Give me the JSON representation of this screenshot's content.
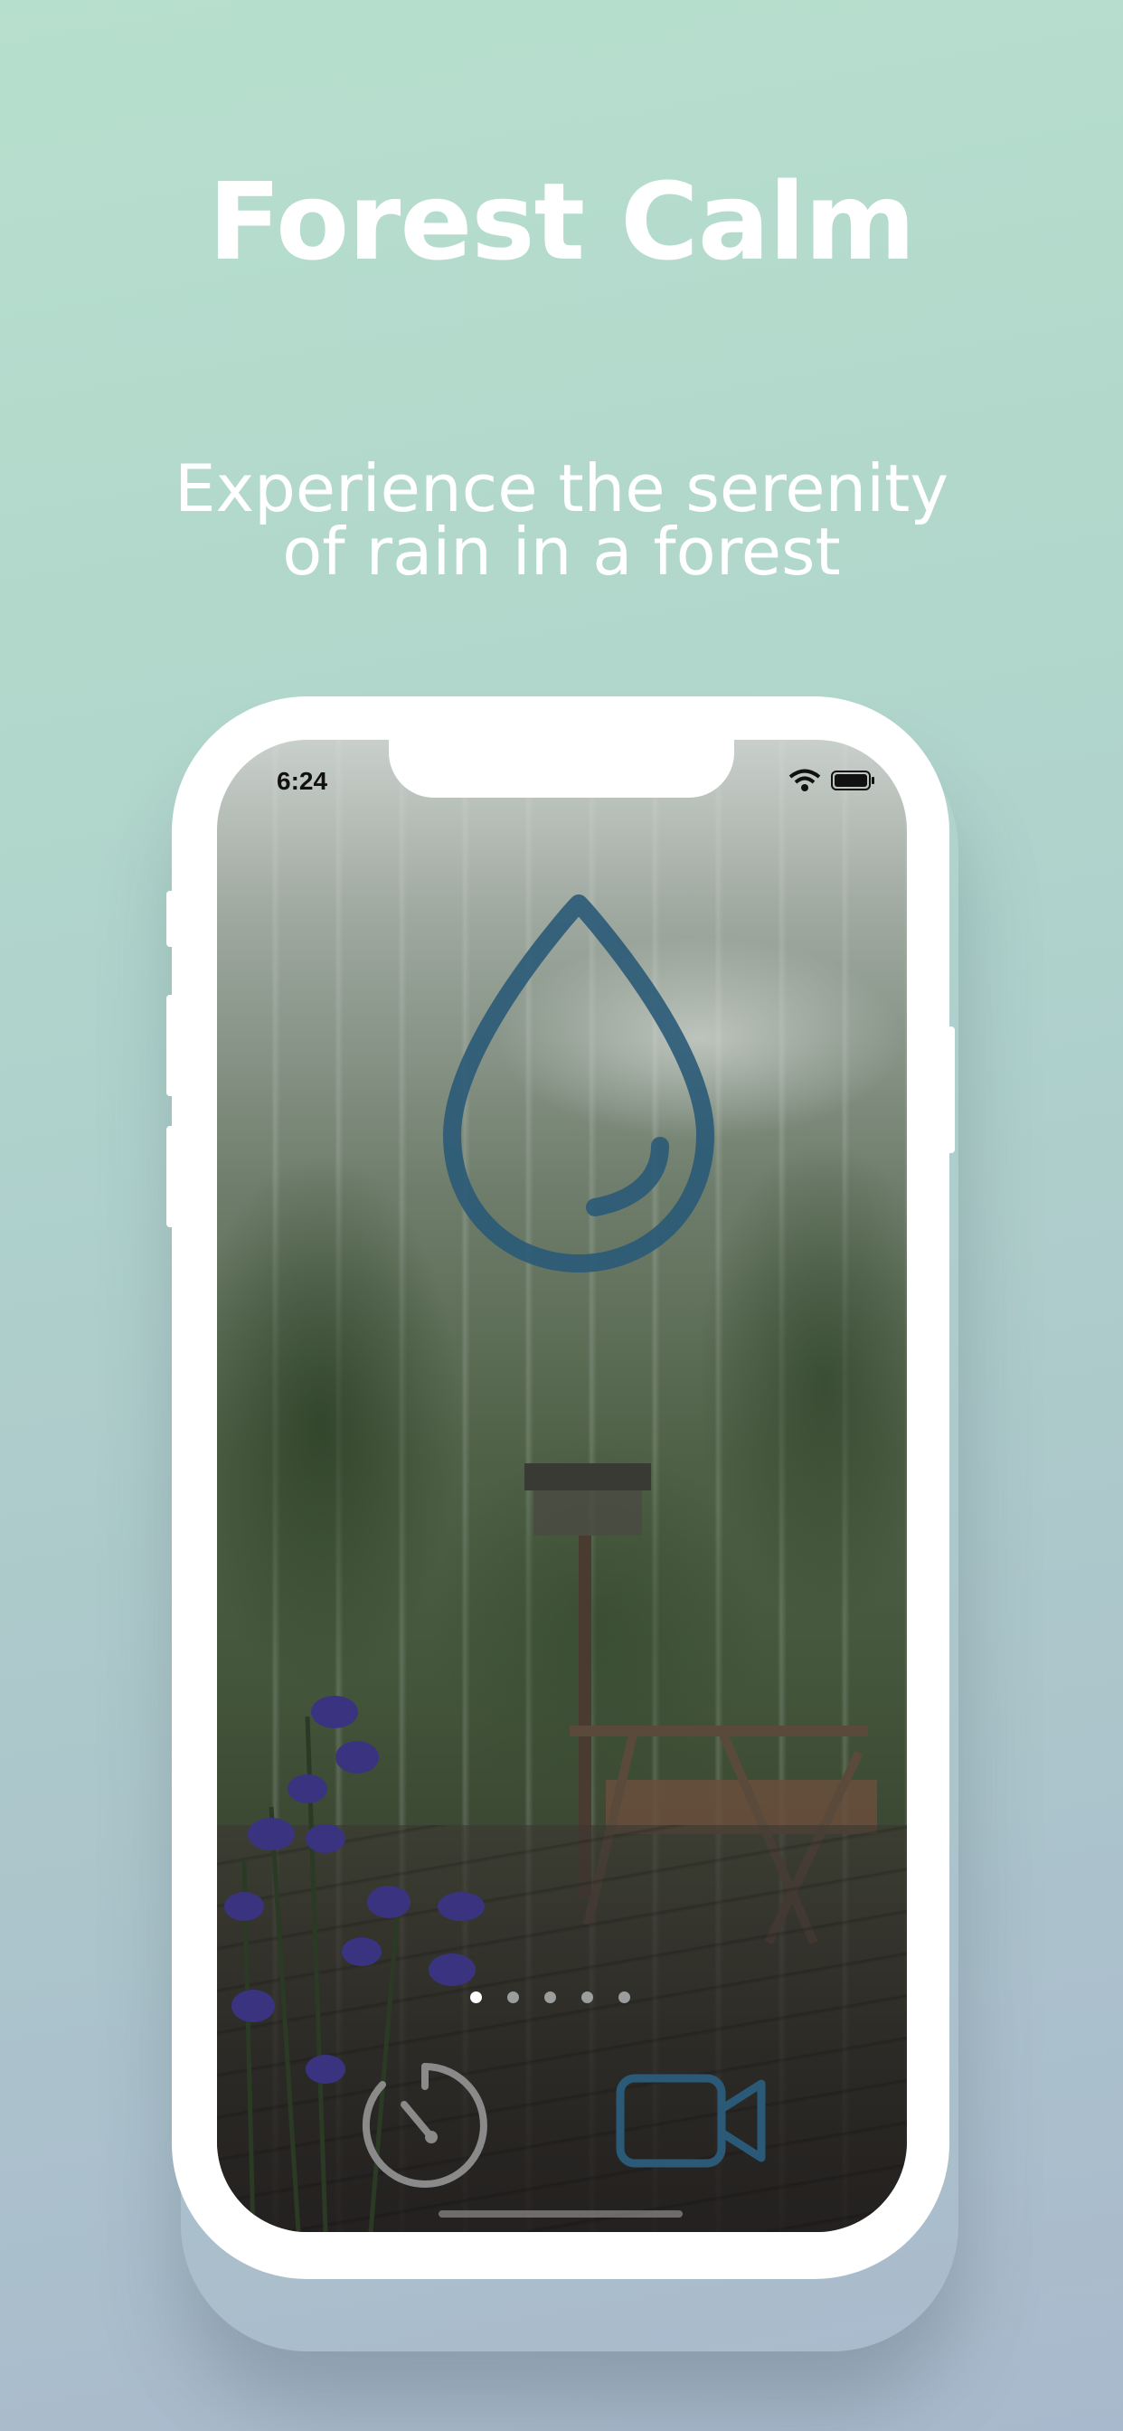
{
  "headline": "Forest Calm",
  "subheadline_line1": "Experience the serenity",
  "subheadline_line2": "of rain in a forest",
  "status_bar": {
    "time": "6:24",
    "icons": [
      "wifi-icon",
      "battery-icon"
    ]
  },
  "main_icon": "raindrop-icon",
  "page_indicator": {
    "count": 5,
    "active_index": 0
  },
  "toolbar": {
    "timer_icon": "timer-icon",
    "video_icon": "video-camera-icon"
  },
  "colors": {
    "accent_blue": "#2a5a78",
    "timer_gray": "#8a8a8a",
    "headline_white": "#ffffff"
  }
}
